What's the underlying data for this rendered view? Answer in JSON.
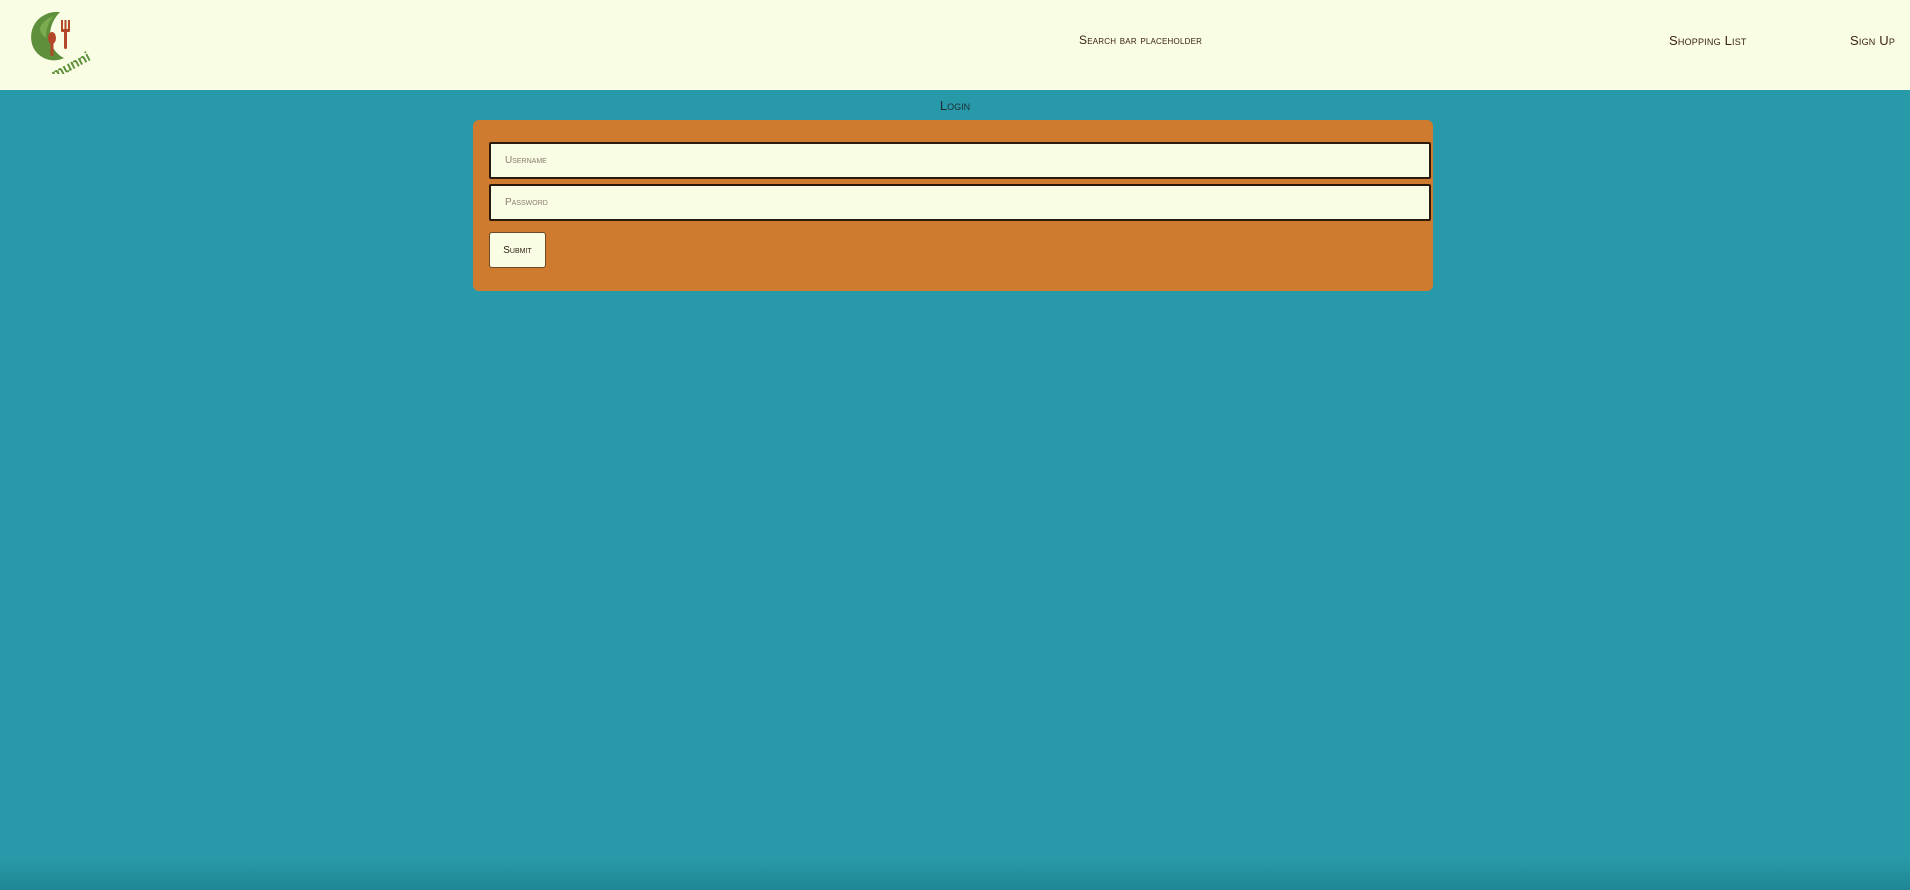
{
  "header": {
    "logo_text": "munni",
    "search_placeholder_text": "Search bar placeholder",
    "nav": {
      "shopping_list": "Shopping List",
      "sign_up": "Sign Up"
    }
  },
  "login": {
    "heading": "Login",
    "username_placeholder": "Username",
    "password_placeholder": "Password",
    "submit_label": "Submit"
  },
  "colors": {
    "header_bg": "#f8fde3",
    "page_bg": "#2899a8",
    "card_bg": "#cf7b2f",
    "logo_green": "#5e8f3a",
    "logo_red": "#b3472a"
  }
}
